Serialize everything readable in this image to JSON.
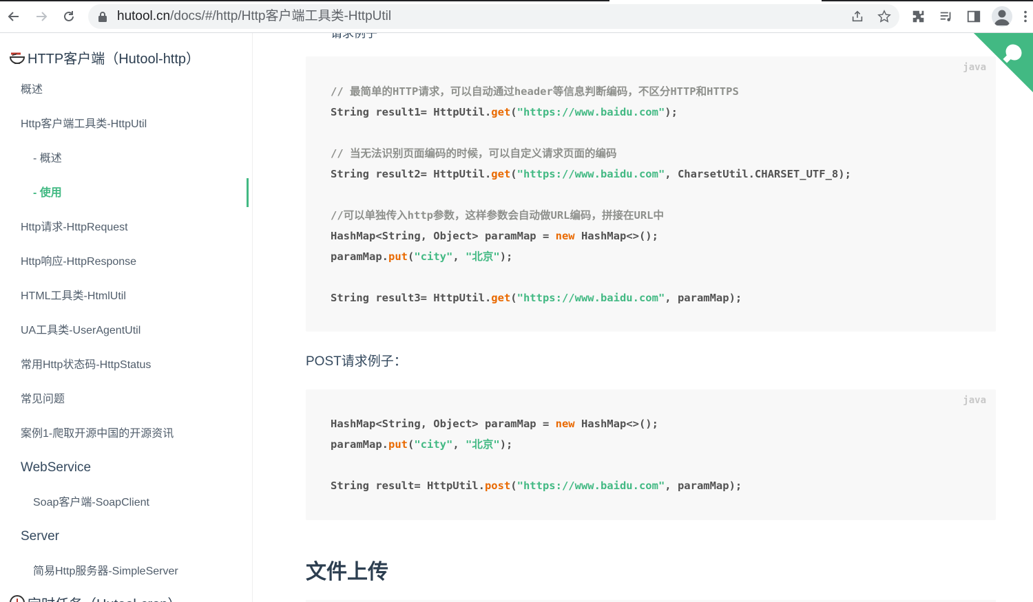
{
  "browser": {
    "url_domain": "hutool.cn",
    "url_path": "/docs/#/http/Http客户端工具类-HttpUtil"
  },
  "sidebar": {
    "header": "HTTP客户端（Hutool-http）",
    "items": [
      {
        "label": "概述"
      },
      {
        "label": "Http客户端工具类-HttpUtil"
      },
      {
        "label": "- 概述"
      },
      {
        "label": "- 使用"
      },
      {
        "label": "Http请求-HttpRequest"
      },
      {
        "label": "Http响应-HttpResponse"
      },
      {
        "label": "HTML工具类-HtmlUtil"
      },
      {
        "label": "UA工具类-UserAgentUtil"
      },
      {
        "label": "常用Http状态码-HttpStatus"
      },
      {
        "label": "常见问题"
      },
      {
        "label": "案例1-爬取开源中国的开源资讯"
      },
      {
        "label": "WebService"
      },
      {
        "label": "Soap客户端-SoapClient"
      },
      {
        "label": "Server"
      },
      {
        "label": "简易Http服务器-SimpleServer"
      }
    ],
    "footer": "定时任务（Hutool-cron）"
  },
  "content": {
    "peek": "请求例子",
    "code1": {
      "lang": "java",
      "c1": "// 最简单的HTTP请求，可以自动通过header等信息判断编码，不区分HTTP和HTTPS",
      "c2": "// 当无法识别页面编码的时候，可以自定义请求页面的编码",
      "c3": "//可以单独传入http参数，这样参数会自动做URL编码，拼接在URL中",
      "l1_a": "String result1= HttpUtil.",
      "l1_f": "get",
      "l1_b": "(",
      "l1_s": "\"https://www.baidu.com\"",
      "l1_c": ");",
      "l2_a": "String result2= HttpUtil.",
      "l2_f": "get",
      "l2_b": "(",
      "l2_s": "\"https://www.baidu.com\"",
      "l2_c": ", CharsetUtil.CHARSET_UTF_8);",
      "l3_a": "HashMap<String, Object> paramMap = ",
      "l3_k": "new",
      "l3_b": " HashMap<>();",
      "l4_a": "paramMap.",
      "l4_f": "put",
      "l4_b": "(",
      "l4_s1": "\"city\"",
      "l4_c": ", ",
      "l4_s2": "\"北京\"",
      "l4_d": ");",
      "l5_a": "String result3= HttpUtil.",
      "l5_f": "get",
      "l5_b": "(",
      "l5_s": "\"https://www.baidu.com\"",
      "l5_c": ", paramMap);"
    },
    "post_label": "POST请求例子：",
    "code2": {
      "lang": "java",
      "l1_a": "HashMap<String, Object> paramMap = ",
      "l1_k": "new",
      "l1_b": " HashMap<>();",
      "l2_a": "paramMap.",
      "l2_f": "put",
      "l2_b": "(",
      "l2_s1": "\"city\"",
      "l2_c": ", ",
      "l2_s2": "\"北京\"",
      "l2_d": ");",
      "l3_a": "String result= HttpUtil.",
      "l3_f": "post",
      "l3_b": "(",
      "l3_s": "\"https://www.baidu.com\"",
      "l3_c": ", paramMap);"
    },
    "heading": "文件上传"
  },
  "colors": {
    "accent": "#42b983",
    "code_fn": "#e96900",
    "code_bg": "#f8f8f8"
  }
}
